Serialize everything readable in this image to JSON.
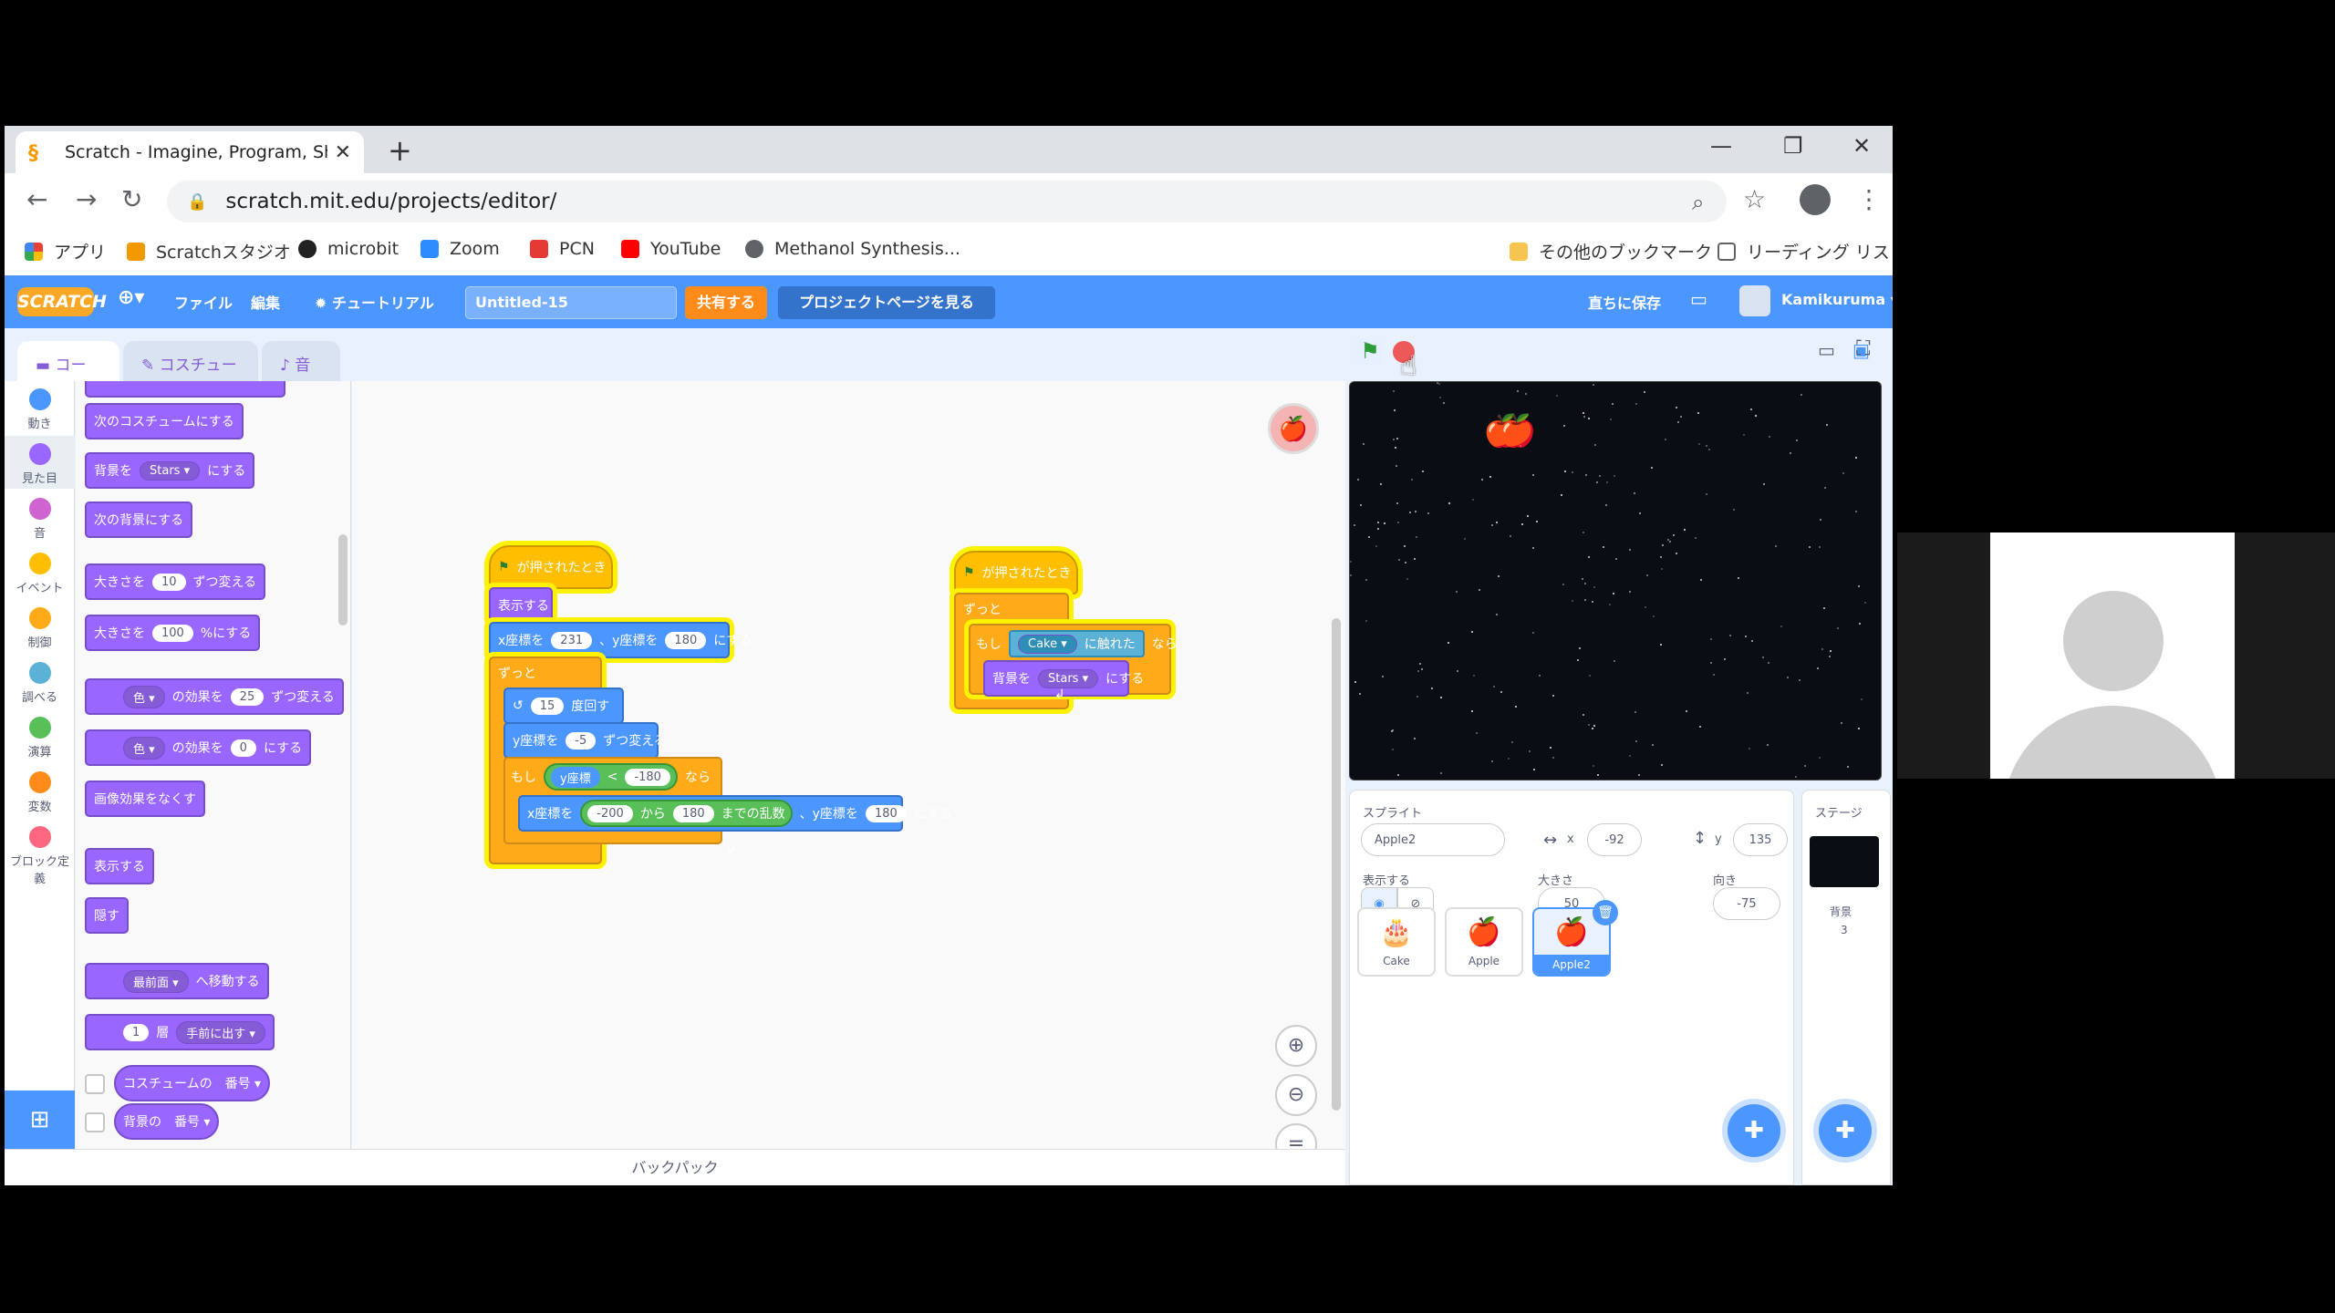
{
  "browser": {
    "tab_title": "Scratch - Imagine, Program, Share",
    "tab_close": "✕",
    "new_tab": "+",
    "url": "scratch.mit.edu/projects/editor/",
    "window_minimize": "—",
    "window_restore": "❐",
    "window_close": "✕",
    "bookmarks": [
      "アプリ",
      "Scratchスタジオ",
      "microbit",
      "Zoom",
      "PCN",
      "YouTube",
      "Methanol Synthesis..."
    ],
    "other_bookmarks": "その他のブックマーク",
    "reading_list": "リーディング リスト"
  },
  "menubar": {
    "logo": "SCRATCH",
    "file": "ファイル",
    "edit": "編集",
    "tutorial": "チュートリアル",
    "project_title": "Untitled-15",
    "share": "共有する",
    "project_page": "プロジェクトページを見る",
    "save_now": "直ちに保存",
    "username": "Kamikuruma"
  },
  "editor_tabs": [
    "コード",
    "コスチューム",
    "音"
  ],
  "categories": [
    {
      "label": "動き",
      "color": "#4c97ff"
    },
    {
      "label": "見た目",
      "color": "#9966ff"
    },
    {
      "label": "音",
      "color": "#cf63cf"
    },
    {
      "label": "イベント",
      "color": "#ffbf00"
    },
    {
      "label": "制御",
      "color": "#ffab19"
    },
    {
      "label": "調べる",
      "color": "#5cb1d6"
    },
    {
      "label": "演算",
      "color": "#59c059"
    },
    {
      "label": "変数",
      "color": "#ff8c1a"
    },
    {
      "label": "ブロック定義",
      "color": "#ff6680"
    }
  ],
  "palette": {
    "next_costume": "次のコスチュームにする",
    "backdrop_to_a": "背景を",
    "backdrop_to_val": "Stars ▾",
    "backdrop_to_b": "にする",
    "next_backdrop": "次の背景にする",
    "change_size_a": "大きさを",
    "change_size_val": "10",
    "change_size_b": "ずつ変える",
    "set_size_a": "大きさを",
    "set_size_val": "100",
    "set_size_b": "%にする",
    "change_effect_drop": "色 ▾",
    "change_effect_a": "の効果を",
    "change_effect_val": "25",
    "change_effect_b": "ずつ変える",
    "set_effect_drop": "色 ▾",
    "set_effect_a": "の効果を",
    "set_effect_val": "0",
    "set_effect_b": "にする",
    "clear_effects": "画像効果をなくす",
    "show": "表示する",
    "hide": "隠す",
    "go_front_drop": "最前面 ▾",
    "go_front_b": "へ移動する",
    "go_layers_val": "1",
    "go_layers_a": "層",
    "go_layers_drop": "手前に出す ▾",
    "costume_number": "コスチュームの　番号 ▾",
    "backdrop_number": "背景の　番号 ▾"
  },
  "script1": {
    "hat": "が押されたとき",
    "show": "表示する",
    "goto_x_label": "x座標を",
    "goto_x": "231",
    "goto_y_label": "、y座標を",
    "goto_y": "180",
    "goto_end": "にする",
    "forever": "ずっと",
    "turn_val": "15",
    "turn_label": "度回す",
    "change_y_label": "y座標を",
    "change_y": "-5",
    "change_y_end": "ずつ変える",
    "if_label": "もし",
    "cond_var": "y座標",
    "cond_op": "<",
    "cond_val": "-180",
    "then_label": "なら",
    "goto2_x_label": "x座標を",
    "rand_from": "-200",
    "rand_mid": "から",
    "rand_to": "180",
    "rand_end": "までの乱数",
    "goto2_y_label": "、y座標を",
    "goto2_y": "180",
    "goto2_end": "にする"
  },
  "script2": {
    "hat": "が押されたとき",
    "forever": "ずっと",
    "if_label": "もし",
    "touch_target": "Cake ▾",
    "touch_label": "に触れた",
    "then_label": "なら",
    "backdrop_a": "背景を",
    "backdrop_val": "Stars ▾",
    "backdrop_b": "にする"
  },
  "backpack": "バックパック",
  "sprite_info": {
    "sprite_label": "スプライト",
    "sprite_name": "Apple2",
    "x_label": "x",
    "x": "-92",
    "y_label": "y",
    "y": "135",
    "show_label": "表示する",
    "size_label": "大きさ",
    "size": "50",
    "direction_label": "向き",
    "direction": "-75"
  },
  "sprites": [
    {
      "name": "Cake",
      "icon": "🎂"
    },
    {
      "name": "Apple",
      "icon": "🍎"
    },
    {
      "name": "Apple2",
      "icon": "🍎"
    }
  ],
  "stage_pane": {
    "title": "ステージ",
    "backdrops_label": "背景",
    "backdrops_count": "3"
  }
}
